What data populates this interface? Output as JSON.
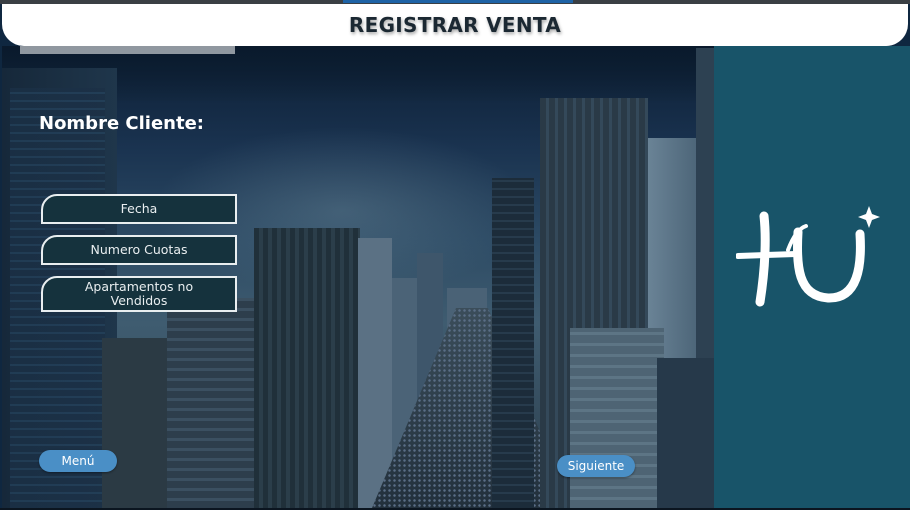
{
  "header": {
    "title": "REGISTRAR VENTA"
  },
  "form": {
    "client_label": "Nombre Cliente:",
    "buttons": {
      "fecha": "Fecha",
      "cuotas": "Numero Cuotas",
      "apartamentos": "Apartamentos no Vendidos"
    }
  },
  "nav": {
    "menu": "Menú",
    "next": "Siguiente"
  },
  "colors": {
    "header_bg": "#ffffff",
    "header_text": "#1b2832",
    "right_panel": "#185469",
    "pill": "#4a8fc6",
    "field_bg": "#15323d"
  },
  "icons": {
    "logo": "hu-logo-icon"
  }
}
